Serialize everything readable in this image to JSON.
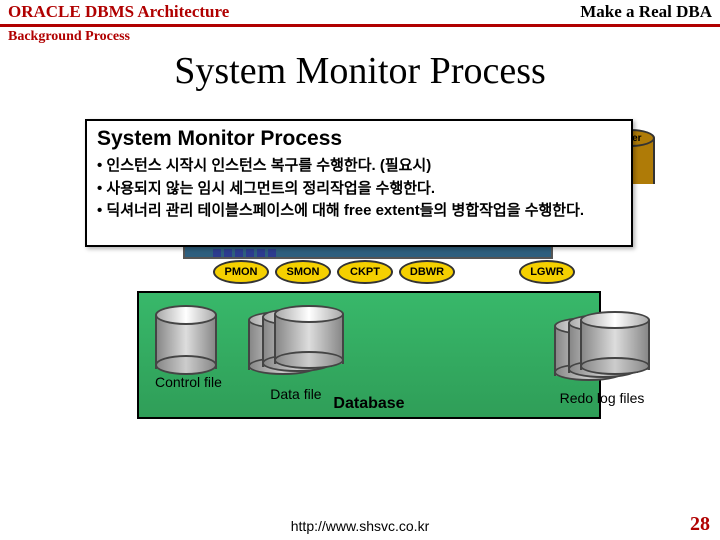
{
  "header": {
    "left": "ORACLE DBMS Architecture",
    "right": "Make a Real DBA",
    "sub": "Background Process"
  },
  "main_title": "System Monitor Process",
  "callout": {
    "title": "System Monitor Process",
    "items": [
      "• 인스턴스 시작시 인스턴스 복구를 수행한다. (필요시)",
      "• 사용되지 않는 임시 세그먼트의 정리작업을 수행한다.",
      "• 딕셔너리 관리 테이블스페이스에 대해 free extent들의 병합작업을 수행한다."
    ]
  },
  "partial_cyl_label": "Log er",
  "processes": {
    "p1": "PMON",
    "p2": "SMON",
    "p3": "CKPT",
    "p4": "DBWR",
    "p5": "LGWR"
  },
  "files": {
    "control": "Control file",
    "data": "Data file",
    "redo": "Redo log files"
  },
  "container_label": "Database",
  "footer_url": "http://www.shsvc.co.kr",
  "page_number": "28"
}
